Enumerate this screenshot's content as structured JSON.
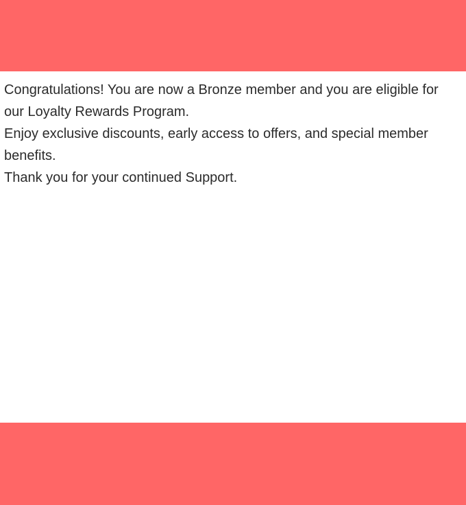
{
  "colors": {
    "banner": "#ff6666",
    "background": "#ffffff",
    "text": "#2b2b2b"
  },
  "message": {
    "line1": "Congratulations! You are now a Bronze member and you are eligible for our Loyalty Rewards Program.",
    "line2": "Enjoy exclusive discounts, early access to offers, and special member benefits.",
    "line3": "Thank you for your continued Support."
  }
}
